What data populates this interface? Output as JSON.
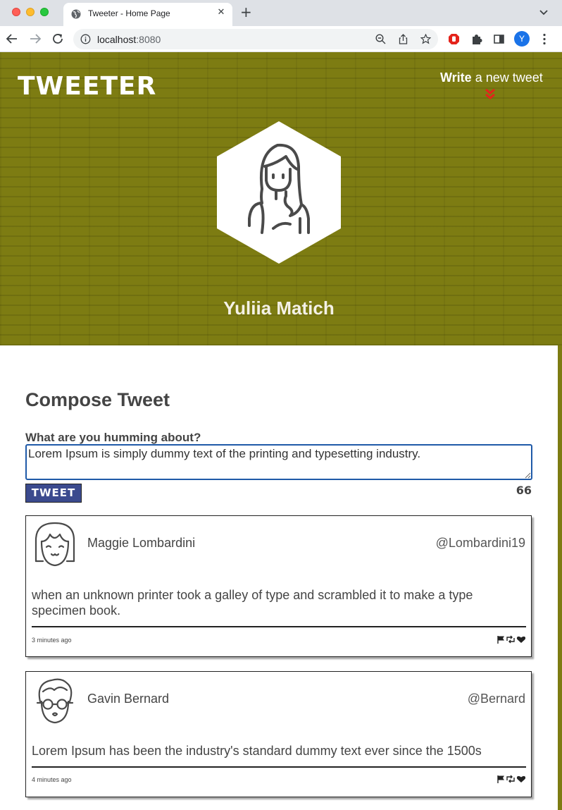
{
  "browser": {
    "tab_title": "Tweeter - Home Page",
    "tab_close": "✕",
    "new_tab": "+",
    "url_host": "localhost",
    "url_port": ":8080",
    "profile_initial": "Y"
  },
  "header": {
    "brand": "TWEETER",
    "nav_write_bold": "Write",
    "nav_write_rest": " a new tweet",
    "user_name": "Yuliia Matich"
  },
  "compose": {
    "title": "Compose Tweet",
    "label": "What are you humming about?",
    "value": "Lorem Ipsum is simply dummy text of the printing and typesetting industry.",
    "button_label": "TWEET",
    "counter": "66"
  },
  "tweets": [
    {
      "name": "Maggie Lombardini",
      "handle": "@Lombardini19",
      "text": "when an unknown printer took a galley of type and scrambled it to make a type specimen book.",
      "time": "3 minutes ago",
      "avatar_icon": "girl-bangs-avatar-icon"
    },
    {
      "name": "Gavin Bernard",
      "handle": "@Bernard",
      "text": "Lorem Ipsum has been the industry's standard dummy text ever since the 1500s",
      "time": "4 minutes ago",
      "avatar_icon": "boy-glasses-avatar-icon"
    }
  ],
  "colors": {
    "header_bg": "#7d7c12",
    "tweet_button": "#3b4a8e",
    "accent_red": "#e4231b"
  }
}
